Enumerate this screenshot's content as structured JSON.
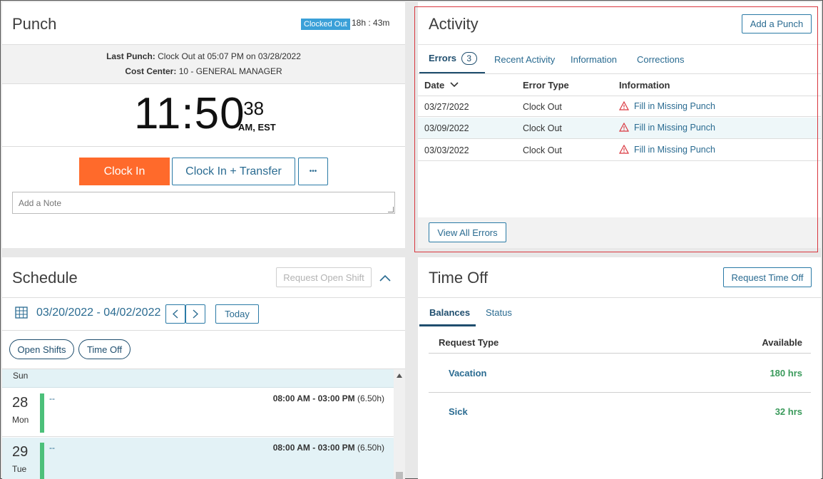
{
  "punch": {
    "title": "Punch",
    "status_badge": "Clocked Out",
    "elapsed": "18h : 43m",
    "last_punch_label": "Last Punch:",
    "last_punch_value": "Clock Out at 05:07 PM on 03/28/2022",
    "cost_center_label": "Cost Center:",
    "cost_center_value": "10 - GENERAL MANAGER",
    "clock_hm": "11:50",
    "clock_sec": ":38",
    "clock_zone": "AM, EST",
    "clock_in_label": "Clock In",
    "clock_in_transfer_label": "Clock In + Transfer",
    "more_label": "•••",
    "note_placeholder": "Add a Note"
  },
  "activity": {
    "title": "Activity",
    "add_punch_label": "Add a Punch",
    "tabs": [
      {
        "label": "Errors",
        "count": "3"
      },
      {
        "label": "Recent Activity"
      },
      {
        "label": "Information"
      },
      {
        "label": "Corrections"
      }
    ],
    "columns": [
      "Date",
      "Error Type",
      "Information"
    ],
    "rows": [
      {
        "date": "03/27/2022",
        "type": "Clock Out",
        "info": "Fill in Missing Punch"
      },
      {
        "date": "03/09/2022",
        "type": "Clock Out",
        "info": "Fill in Missing Punch"
      },
      {
        "date": "03/03/2022",
        "type": "Clock Out",
        "info": "Fill in Missing Punch"
      }
    ],
    "view_all_label": "View All Errors",
    "highlight_color": "#d9363e"
  },
  "schedule": {
    "title": "Schedule",
    "request_open_shift_label": "Request Open Shift",
    "date_range": "03/20/2022 - 04/02/2022",
    "today_label": "Today",
    "filters": [
      "Open Shifts",
      "Time Off"
    ],
    "day_header": "Sun",
    "days": [
      {
        "num": "28",
        "dow": "Mon",
        "dash": "--",
        "time": "08:00 AM - 03:00 PM",
        "hours": "(6.50h)"
      },
      {
        "num": "29",
        "dow": "Tue",
        "dash": "--",
        "time": "08:00 AM - 03:00 PM",
        "hours": "(6.50h)"
      }
    ]
  },
  "timeoff": {
    "title": "Time Off",
    "request_label": "Request Time Off",
    "tabs": [
      "Balances",
      "Status"
    ],
    "col_type": "Request Type",
    "col_available": "Available",
    "rows": [
      {
        "type": "Vacation",
        "available": "180 hrs"
      },
      {
        "type": "Sick",
        "available": "32 hrs"
      }
    ]
  },
  "colors": {
    "accent_orange": "#ff6a2b",
    "badge_blue": "#3aa0d8",
    "green": "#3a9a5b",
    "schedule_bar": "#4cc07a"
  }
}
